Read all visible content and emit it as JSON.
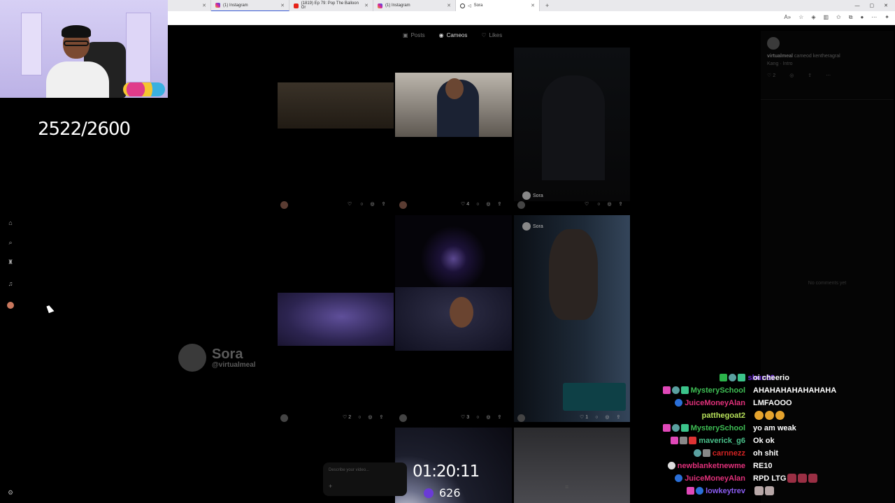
{
  "browser": {
    "tabs": [
      {
        "label": "",
        "favicon": "instagram-icon"
      },
      {
        "label": "(1) Instagram",
        "favicon": "instagram-icon"
      },
      {
        "label": "(1819) Ep 79: Pop The Balloon Or",
        "favicon": "youtube-icon"
      },
      {
        "label": "(1) Instagram",
        "favicon": "instagram-icon"
      },
      {
        "label": "Sora",
        "favicon": "sora-icon",
        "active": true
      }
    ],
    "new_tab": "+"
  },
  "stream": {
    "sub_counter": "2522/2600",
    "timer": "01:20:11",
    "viewers": "626"
  },
  "profile_tabs": [
    {
      "label": "Posts",
      "icon": "posts-icon"
    },
    {
      "label": "Cameos",
      "icon": "cameos-icon",
      "active": true
    },
    {
      "label": "Likes",
      "icon": "heart-icon"
    }
  ],
  "grid": {
    "row1": {
      "cell1_likes": "",
      "cell2_likes": "4",
      "cell3_likes": "",
      "cell3_watermark": "Sora"
    },
    "row2": {
      "cell1_likes": "2",
      "cell2_likes": "3",
      "cell3_likes": "1",
      "cell3_watermark": "Sora"
    },
    "big_watermark": {
      "name": "Sora",
      "handle": "@virtualmeal"
    }
  },
  "detail_panel": {
    "username": "virtualmeal",
    "byline": "cameod kentheragral",
    "caption": "Kang · Intro",
    "like_count": "2",
    "empty_comments": "No comments yet"
  },
  "prompt": {
    "placeholder": "Describe your video..."
  },
  "chat": [
    {
      "user": "shun69",
      "color": "#6c2bd9",
      "msg": "oi cheerio",
      "emotes": 0,
      "badges": [
        "b-green",
        "b-teal",
        "b-gift"
      ]
    },
    {
      "user": "MysterySchool",
      "color": "#3fbf55",
      "msg": "AHAHAHAHAHAHAHA",
      "emotes": 0,
      "badges": [
        "b-pink",
        "b-teal",
        "b-gift"
      ]
    },
    {
      "user": "JuiceMoneyAlan",
      "color": "#e0307a",
      "msg": "LMFAOOO",
      "emotes": 0,
      "badges": [
        "b-blue"
      ]
    },
    {
      "user": "patthegoat2",
      "color": "#b6e05a",
      "msg": "",
      "emotes": 3,
      "badges": []
    },
    {
      "user": "MysterySchool",
      "color": "#3fbf55",
      "msg": "yo am weak",
      "emotes": 0,
      "badges": [
        "b-pink",
        "b-teal",
        "b-gift"
      ]
    },
    {
      "user": "maverick_g6",
      "color": "#49c08a",
      "msg": "Ok ok",
      "emotes": 0,
      "badges": [
        "b-pink",
        "b-grey",
        "b-red"
      ]
    },
    {
      "user": "carnnezz",
      "color": "#d32323",
      "msg": "oh shit",
      "emotes": 0,
      "badges": [
        "b-teal",
        "b-grey"
      ]
    },
    {
      "user": "newblanketnewme",
      "color": "#e0307a",
      "msg": "RE10",
      "emotes": 0,
      "badges": [
        "b-skull"
      ]
    },
    {
      "user": "JuiceMoneyAlan",
      "color": "#e0307a",
      "msg": "RPD LTG",
      "emotes": 3,
      "badges": [
        "b-blue"
      ]
    },
    {
      "user": "lowkeytrev",
      "color": "#8a5cf0",
      "msg": "",
      "emotes": 2,
      "badges": [
        "b-pink",
        "b-blue"
      ]
    }
  ]
}
